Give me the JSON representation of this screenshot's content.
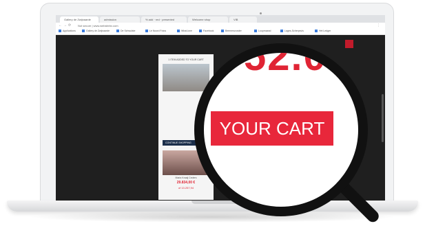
{
  "browser": {
    "tabs": [
      "Gallery de Zwijnaarde",
      "admission",
      "% add · red · presented",
      "Welcome shop",
      "VIB"
    ],
    "url": "Not secure  |  www.websitebx.com",
    "bookmarks": [
      "Applications",
      "Gallery de Zwijnaarde",
      "De Schwulste",
      "Le Noord Fotos",
      "What-lone",
      "Facebook",
      "Beemenzonder",
      "Loopmaand",
      "Lages-Scherpsvis",
      "Het Ledger"
    ]
  },
  "modal": {
    "title": "1 ITEM ADDED TO YOUR CART",
    "continue_label": "CONTINUE SHOPPING",
    "price": "29.834,00 €",
    "price_sub": "of 13.257,94",
    "product_label": "Maria Kraaij Ceders"
  },
  "magnifier": {
    "button_label": "YOUR CART",
    "partial_text": "52.0"
  },
  "colors": {
    "accent": "#e8273b",
    "lens_rim": "#111111",
    "modal_button": "#1b2e4a"
  }
}
